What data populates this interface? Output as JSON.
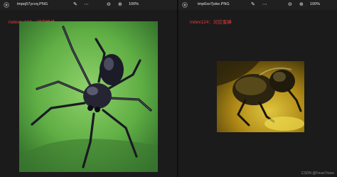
{
  "left_window": {
    "filename": "tmpq57ycvq.PNG",
    "zoom": "100%",
    "caption": "index：123，对应蛛蛛"
  },
  "right_window": {
    "filename": "tmp6xo7joke.PNG",
    "zoom": "100%",
    "caption": "index124：对应蜜蜂"
  },
  "icons": [
    "app-icon",
    "edit-icon",
    "more-icon",
    "zoom-out-icon",
    "zoom-in-icon"
  ],
  "watermark": "CSDN @FeverTwice"
}
